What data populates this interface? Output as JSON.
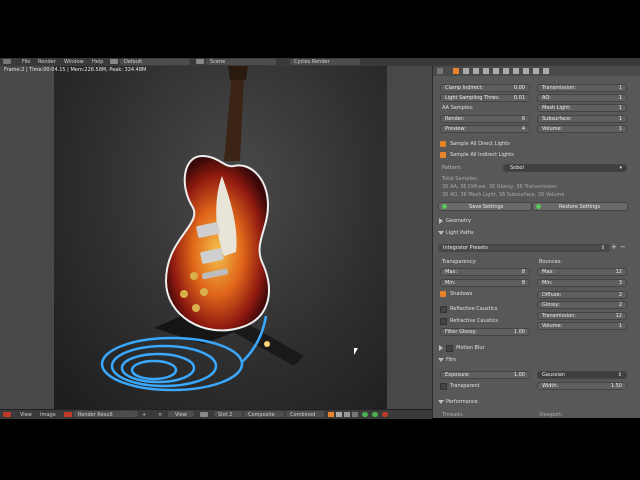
{
  "topbar": {
    "menus": [
      "File",
      "Render",
      "Window",
      "Help"
    ],
    "layout": "Default",
    "scene": "Scene",
    "engine": "Cycles Render"
  },
  "editor": {
    "status": "Frame:2 | Time:00:04.15 | Mem:228.58M, Peak: 324.48M",
    "bottom": {
      "view": "View",
      "image": "Image",
      "image_name": "Render Result",
      "view2": "View",
      "slot": "Slot 2",
      "layer": "Composite",
      "pass": "Combined"
    }
  },
  "props": {
    "clamp_indirect_label": "Clamp Indirect:",
    "clamp_indirect_value": "0.00",
    "light_thresh_label": "Light Sampling Thres:",
    "light_thresh_value": "0.01",
    "aa_samples": "AA Samples:",
    "render_label": "Render:",
    "render_value": "6",
    "preview_label": "Preview:",
    "preview_value": "4",
    "transmission_label": "Transmission:",
    "transmission_value": "1",
    "ao_label": "AO:",
    "ao_value": "1",
    "mesh_light_label": "Mesh Light:",
    "mesh_light_value": "1",
    "subsurface_label": "Subsurface:",
    "subsurface_value": "1",
    "volume_label": "Volume:",
    "volume_value": "1",
    "sample_direct": "Sample All Direct Lights",
    "sample_indirect": "Sample All Indirect Lights",
    "pattern_label": "Pattern:",
    "pattern_value": "Sobol",
    "total_samples": "Total Samples:",
    "samples_line1": "36 AA, 36 Diffuse, 36 Glossy, 36 Transmission",
    "samples_line2": "36 AO, 36 Mesh Light, 36 Subsurface, 36 Volume",
    "save_settings": "Save Settings",
    "restore_settings": "Restore Settings",
    "geometry": "Geometry",
    "light_paths": "Light Paths",
    "integrator_presets": "Integrator Presets",
    "transparency": "Transparency:",
    "t_max_label": "Max:",
    "t_max_value": "8",
    "t_min_label": "Min:",
    "t_min_value": "8",
    "shadows": "Shadows",
    "bounces": "Bounces:",
    "b_max_label": "Max:",
    "b_max_value": "12",
    "b_min_label": "Min:",
    "b_min_value": "3",
    "diffuse_label": "Diffuse:",
    "diffuse_value": "2",
    "glossy_label": "Glossy:",
    "glossy_value": "2",
    "b_transmission_label": "Transmission:",
    "b_transmission_value": "12",
    "b_volume_label": "Volume:",
    "b_volume_value": "1",
    "reflective_caustics": "Reflective Caustics",
    "refractive_caustics": "Refractive Caustics",
    "filter_glossy_label": "Filter Glossy:",
    "filter_glossy_value": "1.00",
    "motion_blur": "Motion Blur",
    "film": "Film",
    "exposure_label": "Exposure:",
    "exposure_value": "1.00",
    "transparent": "Transparent",
    "filter_type": "Gaussian",
    "width_label": "Width:",
    "width_value": "1.50",
    "performance": "Performance",
    "threads": "Threads:",
    "viewport": "Viewport:"
  },
  "colors": {
    "accent": "#e8852a",
    "panel_bg": "#585858",
    "header_bg": "#3a3a3a"
  }
}
